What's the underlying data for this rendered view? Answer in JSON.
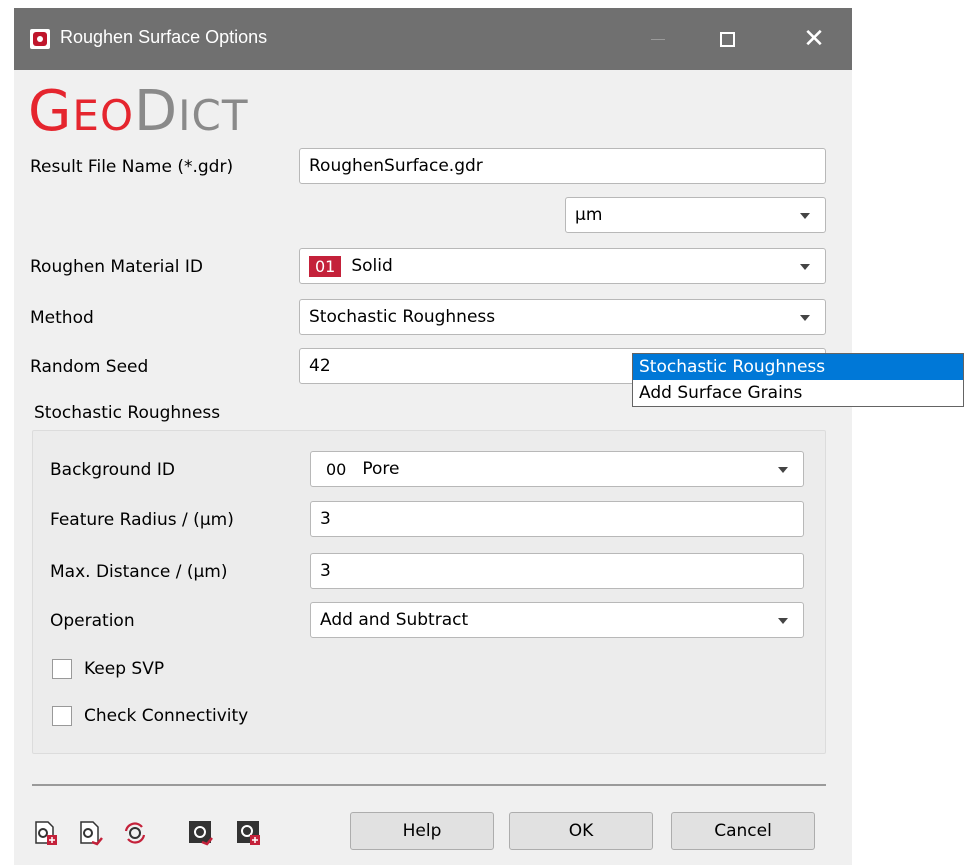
{
  "window": {
    "title": "Roughen Surface Options"
  },
  "logo": {
    "part1_big": "G",
    "part1_small": "EO",
    "part2_big": "D",
    "part2_small": "ICT"
  },
  "form": {
    "result_file_label": "Result File Name (*.gdr)",
    "result_file_value": "RoughenSurface.gdr",
    "unit_value": "µm",
    "material_label": "Roughen Material ID",
    "material_id": "01",
    "material_name": "Solid",
    "method_label": "Method",
    "method_value": "Stochastic Roughness",
    "seed_label": "Random Seed",
    "seed_value": "42"
  },
  "group": {
    "title": "Stochastic Roughness",
    "background_label": "Background ID",
    "background_id": "00",
    "background_name": "Pore",
    "radius_label": "Feature Radius / (µm)",
    "radius_value": "3",
    "distance_label": "Max. Distance / (µm)",
    "distance_value": "3",
    "operation_label": "Operation",
    "operation_value": "Add and Subtract",
    "keep_svp_label": "Keep SVP",
    "keep_svp_checked": false,
    "connectivity_label": "Check Connectivity",
    "connectivity_checked": false
  },
  "dropdown": {
    "options": [
      "Stochastic Roughness",
      "Add Surface Grains"
    ],
    "selected": "Stochastic Roughness"
  },
  "buttons": {
    "help": "Help",
    "ok": "OK",
    "cancel": "Cancel"
  },
  "icons": [
    "load-settings-icon",
    "save-settings-icon",
    "reset-settings-icon",
    "run-macro-icon",
    "save-macro-icon"
  ],
  "colors": {
    "brand_red": "#e5252e",
    "material_badge": "#c4213a",
    "selection_blue": "#0078d7"
  }
}
